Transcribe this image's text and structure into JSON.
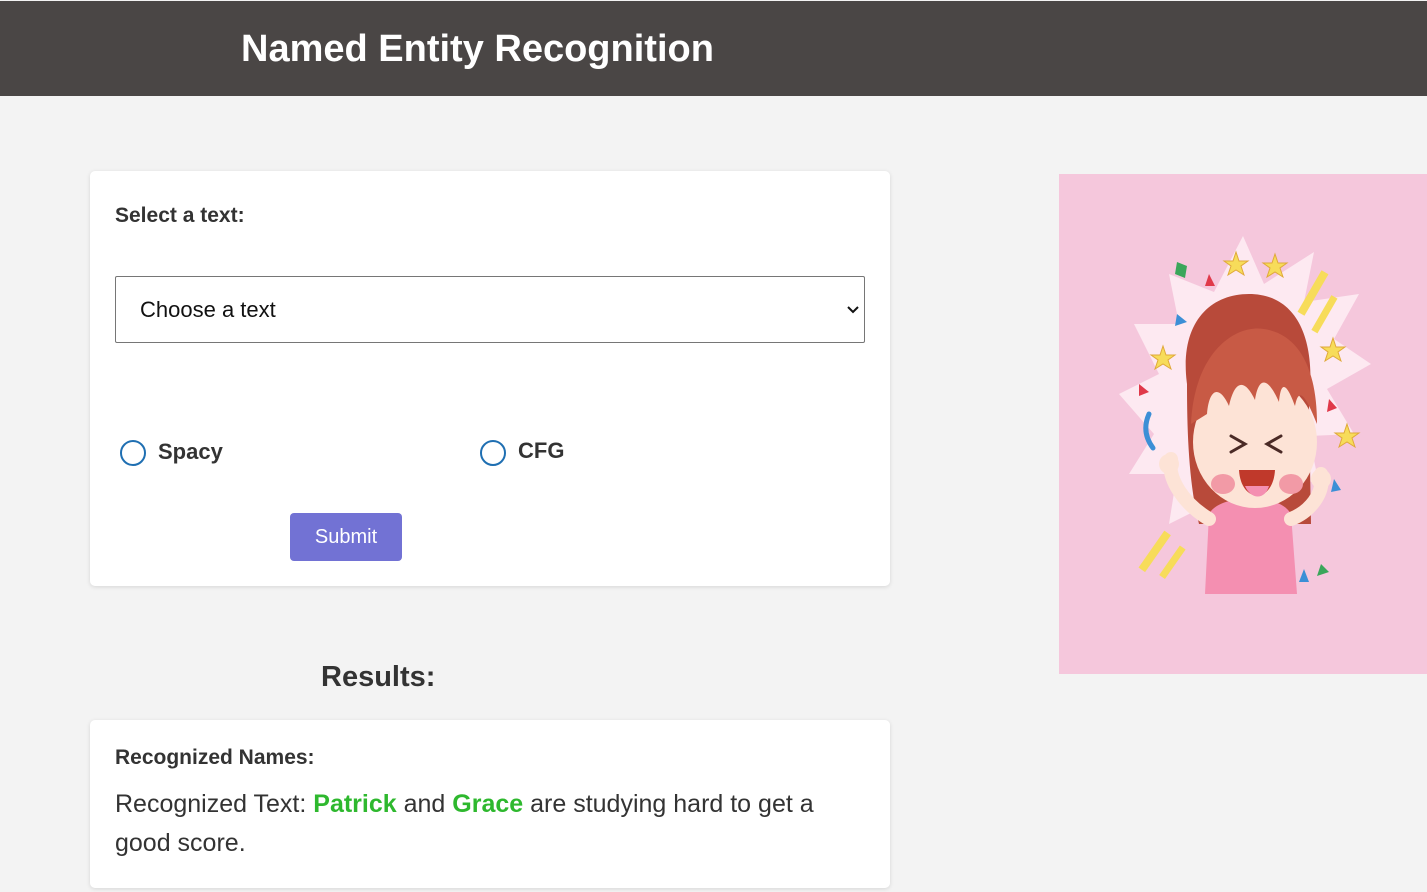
{
  "header": {
    "title": "Named Entity Recognition"
  },
  "form": {
    "select_label": "Select a text:",
    "select_value": "Choose a text",
    "radios": [
      {
        "label": "Spacy",
        "checked": false
      },
      {
        "label": "CFG",
        "checked": false
      }
    ],
    "submit_label": "Submit"
  },
  "results": {
    "title": "Results:",
    "heading": "Recognized Names:",
    "text_prefix": "Recognized Text: ",
    "entity_1": "Patrick",
    "connector": " and ",
    "entity_2": "Grace",
    "text_suffix": " are studying hard to get a good score."
  },
  "colors": {
    "header_bg": "#4a4645",
    "button_bg": "#7272d4",
    "entity": "#2eb82e",
    "illustration_bg": "#f5c7dc"
  },
  "illustration": {
    "subject": "excited cartoon girl with confetti"
  }
}
